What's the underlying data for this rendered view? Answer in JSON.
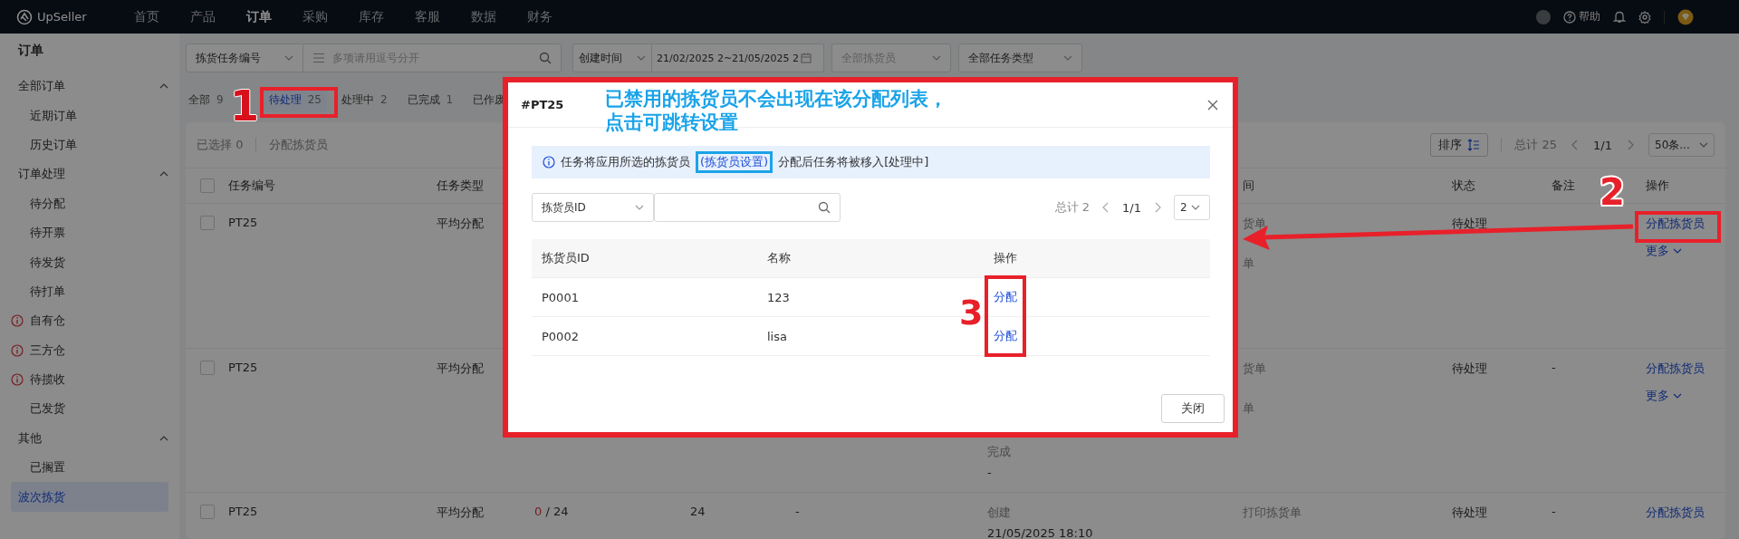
{
  "top_nav": {
    "brand": "UpSeller",
    "items": [
      {
        "label": "首页",
        "selected": false
      },
      {
        "label": "产品",
        "selected": false
      },
      {
        "label": "订单",
        "selected": true
      },
      {
        "label": "采购",
        "selected": false
      },
      {
        "label": "库存",
        "selected": false
      },
      {
        "label": "客服",
        "selected": false
      },
      {
        "label": "数据",
        "selected": false
      },
      {
        "label": "财务",
        "selected": false
      }
    ],
    "help": "帮助"
  },
  "sidebar": {
    "title": "订单",
    "items": [
      {
        "label": "全部订单",
        "expanded": true,
        "selected": false,
        "children": [
          {
            "label": "近期订单",
            "selected": false,
            "alert": false
          },
          {
            "label": "历史订单",
            "selected": false,
            "alert": false
          }
        ]
      },
      {
        "label": "订单处理",
        "expanded": true,
        "selected": false,
        "children": [
          {
            "label": "待分配",
            "selected": false,
            "alert": false
          },
          {
            "label": "待开票",
            "selected": false,
            "alert": false
          },
          {
            "label": "待发货",
            "selected": false,
            "alert": false
          },
          {
            "label": "待打单",
            "selected": false,
            "alert": false
          },
          {
            "label": "自有仓",
            "selected": false,
            "alert": true
          },
          {
            "label": "三方仓",
            "selected": false,
            "alert": true
          },
          {
            "label": "待揽收",
            "selected": false,
            "alert": true
          },
          {
            "label": "已发货",
            "selected": false,
            "alert": false
          }
        ]
      },
      {
        "label": "其他",
        "expanded": true,
        "selected": false,
        "children": [
          {
            "label": "已搁置",
            "selected": false,
            "alert": false
          }
        ]
      },
      {
        "label": "波次拣货",
        "selected": true
      }
    ]
  },
  "filters": [
    {
      "kind": "select",
      "value": "拣货任务编号"
    },
    {
      "kind": "search",
      "placeholder": "多项请用逗号分开"
    },
    {
      "kind": "select",
      "value": "创建时间"
    },
    {
      "kind": "date",
      "value": "21/02/2025 2~21/05/2025 2"
    },
    {
      "kind": "select",
      "placeholder": "全部拣货员"
    },
    {
      "kind": "select",
      "value": "全部任务类型"
    }
  ],
  "tabs": [
    {
      "label": "全部",
      "count": "9",
      "selected": false
    },
    {
      "label": "待处理",
      "count": "25",
      "selected": true
    },
    {
      "label": "处理中",
      "count": "2",
      "selected": false
    },
    {
      "label": "已完成",
      "count": "1",
      "selected": false
    },
    {
      "label": "已作废",
      "selected": false
    }
  ],
  "toolbar": {
    "selected_count": "已选择 0",
    "bulk_action": "分配拣货员",
    "sort": "排序",
    "total": "总计 25",
    "page": "1/1",
    "page_size": "50条..."
  },
  "table": {
    "all_checked": false,
    "columns": {
      "task_no": "任务编号",
      "task_type": "任务类型",
      "print_log": "间",
      "status": "状态",
      "remark": "备注",
      "actions": "操作"
    },
    "rows": [
      {
        "checked": false,
        "task_no": "PT25",
        "task_type": "平均分配",
        "print_log": [
          "货单",
          "单"
        ],
        "status": "待处理",
        "action": "分配拣货员",
        "more": "更多"
      },
      {
        "checked": false,
        "task_no": "PT25",
        "task_type": "平均分配",
        "time_log_tail": [
          "完成",
          "-"
        ],
        "print_log": [
          "货单",
          "单"
        ],
        "status": "待处理",
        "remark": "-",
        "action": "分配拣货员",
        "more": "更多"
      },
      {
        "checked": false,
        "task_no": "PT25",
        "task_type": "平均分配",
        "progress_done": "0",
        "progress_total": "/ 24",
        "qty": "24",
        "col_5": "-",
        "time_log": [
          "创建",
          "21/05/2025 18:10"
        ],
        "print_log": [
          "打印拣货单"
        ],
        "status": "待处理",
        "remark": "-",
        "action": "分配拣货员"
      }
    ]
  },
  "modal": {
    "title": "#PT25",
    "info": "任务将应用所选的拣货员",
    "info_link": "(拣货员设置)",
    "info_after": "分配后任务将被移入[处理中]",
    "filter": "拣货员ID",
    "total": "总计 2",
    "page": "1/1",
    "page_size": "2",
    "columns": [
      "拣货员ID",
      "名称",
      "操作"
    ],
    "rows": [
      {
        "id": "P0001",
        "name": "123",
        "action": "分配"
      },
      {
        "id": "P0002",
        "name": "lisa",
        "action": "分配"
      }
    ],
    "close_button": "关闭"
  },
  "annotations": {
    "hint": [
      "已禁用的拣货员不会出现在该分配列表，",
      "点击可跳转设置"
    ],
    "markers": [
      "1",
      "2",
      "3"
    ]
  }
}
